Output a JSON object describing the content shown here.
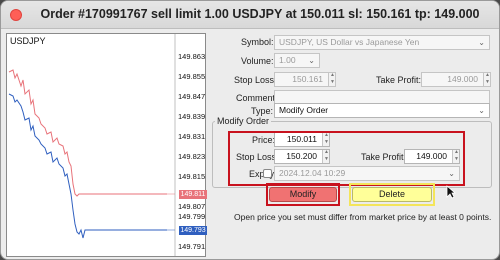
{
  "window": {
    "title": "Order #170991767 sell limit 1.00 USDJPY at 150.011 sl: 150.161 tp: 149.000"
  },
  "chart": {
    "symbol": "USDJPY",
    "price_labels": [
      "149.863",
      "149.855",
      "149.847",
      "149.839",
      "149.831",
      "149.823",
      "149.815",
      "149.807",
      "149.799",
      "149.791"
    ],
    "ask_tag": "149.811",
    "bid_tag": "149.793",
    "ask_color": "#e8737a",
    "bid_color": "#2f5fbf"
  },
  "form": {
    "symbol_label": "Symbol:",
    "symbol_value": "USDJPY, US Dollar vs Japanese Yen",
    "volume_label": "Volume:",
    "volume_value": "1.00",
    "sl_label": "Stop Loss:",
    "sl_value": "150.161",
    "tp_label": "Take Profit:",
    "tp_value": "149.000",
    "comment_label": "Comment:",
    "comment_value": "",
    "type_label": "Type:",
    "type_value": "Modify Order"
  },
  "modify": {
    "group_title": "Modify Order",
    "price_label": "Price:",
    "price_value": "150.011",
    "sl_label": "Stop Loss:",
    "sl_value": "150.200",
    "tp_label": "Take Profit:",
    "tp_value": "149.000",
    "expiry_label": "Expiry:",
    "expiry_value": "2024.12.04 10:29",
    "expiry_checked": false
  },
  "buttons": {
    "modify": "Modify",
    "delete": "Delete"
  },
  "message": "Open price you set must differ from market price by at least 0 points."
}
